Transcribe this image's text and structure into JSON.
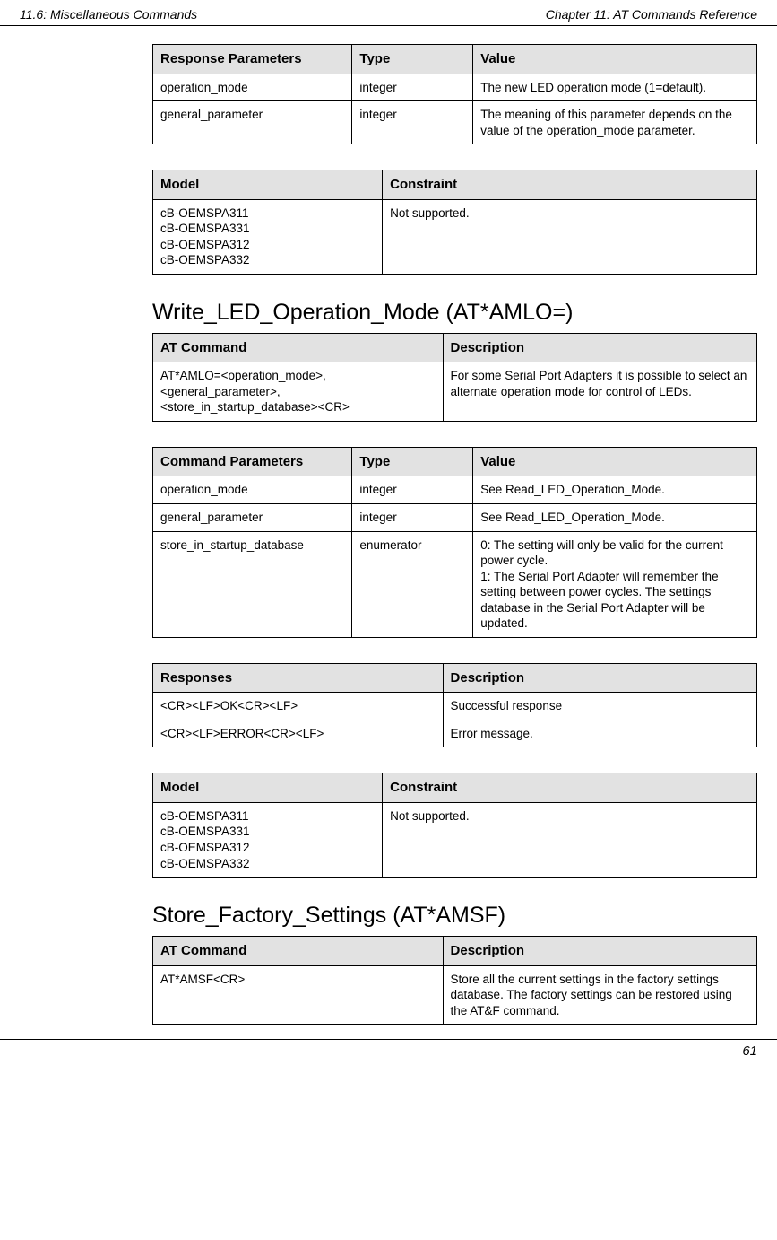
{
  "header": {
    "left": "11.6: Miscellaneous Commands",
    "right": "Chapter 11: AT Commands Reference"
  },
  "footer": {
    "page": "61"
  },
  "table1": {
    "headers": [
      "Response Parameters",
      "Type",
      "Value"
    ],
    "rows": [
      {
        "c1": "operation_mode",
        "c2": "integer",
        "c3": "The new LED operation mode (1=default)."
      },
      {
        "c1": "general_parameter",
        "c2": "integer",
        "c3": "The meaning of this parameter depends on the value of the operation_mode parameter."
      }
    ]
  },
  "table2": {
    "headers": [
      "Model",
      "Constraint"
    ],
    "rows": [
      {
        "c1": "cB-OEMSPA311\ncB-OEMSPA331\ncB-OEMSPA312\ncB-OEMSPA332",
        "c2": "Not supported."
      }
    ]
  },
  "section1_title": "Write_LED_Operation_Mode (AT*AMLO=)",
  "table3": {
    "headers": [
      "AT Command",
      "Description"
    ],
    "rows": [
      {
        "c1": "AT*AMLO=<operation_mode>,  <general_parameter>, <store_in_startup_database><CR>",
        "c2": "For some Serial Port Adapters it is possible to select an alternate operation mode for control of LEDs."
      }
    ]
  },
  "table4": {
    "headers": [
      "Command Parameters",
      "Type",
      "Value"
    ],
    "rows": [
      {
        "c1": "operation_mode",
        "c2": "integer",
        "c3": "See Read_LED_Operation_Mode."
      },
      {
        "c1": "general_parameter",
        "c2": "integer",
        "c3": "See Read_LED_Operation_Mode."
      },
      {
        "c1": "store_in_startup_database",
        "c2": "enumerator",
        "c3": "0: The setting will only be valid for the current power cycle.\n1: The Serial Port Adapter will remember the setting between power cycles. The settings database in the Serial Port Adapter will be updated."
      }
    ]
  },
  "table5": {
    "headers": [
      "Responses",
      "Description"
    ],
    "rows": [
      {
        "c1": "<CR><LF>OK<CR><LF>",
        "c2": "Successful response"
      },
      {
        "c1": "<CR><LF>ERROR<CR><LF>",
        "c2": "Error message."
      }
    ]
  },
  "table6": {
    "headers": [
      "Model",
      "Constraint"
    ],
    "rows": [
      {
        "c1": "cB-OEMSPA311\ncB-OEMSPA331\ncB-OEMSPA312\ncB-OEMSPA332",
        "c2": "Not supported."
      }
    ]
  },
  "section2_title": "Store_Factory_Settings (AT*AMSF)",
  "table7": {
    "headers": [
      "AT Command",
      "Description"
    ],
    "rows": [
      {
        "c1": "AT*AMSF<CR>",
        "c2": "Store all the current settings in the factory settings database. The factory settings can be restored using the AT&F command."
      }
    ]
  }
}
